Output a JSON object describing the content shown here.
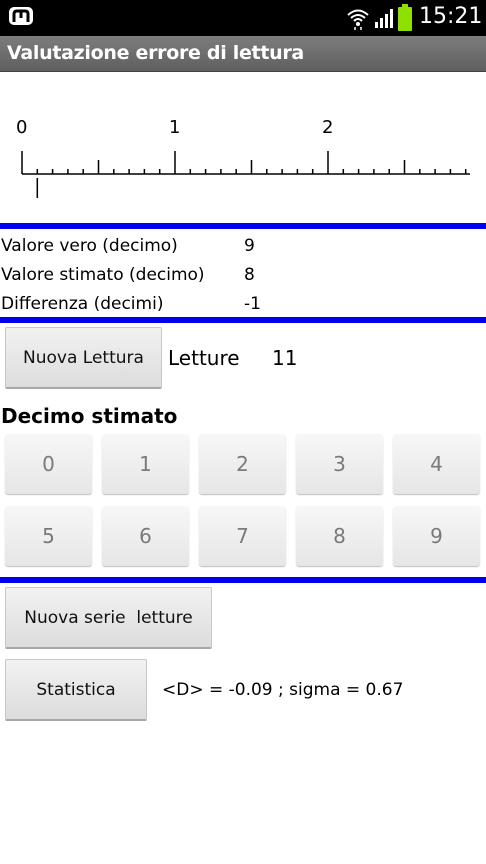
{
  "status_bar": {
    "time": "15:21",
    "icons": [
      "app-notification-icon",
      "wifi-icon",
      "signal-icon",
      "battery-icon"
    ],
    "battery_color": "#8ee000"
  },
  "app": {
    "title": "Valutazione errore di lettura"
  },
  "ruler": {
    "labels": [
      "0",
      "1",
      "2"
    ],
    "units_shown": 3,
    "divisions_per_unit": 10,
    "pointer_value": 0.1,
    "color": "#000000"
  },
  "info": {
    "valore_vero": {
      "label": "Valore vero (decimo)",
      "value": "9"
    },
    "valore_stimato": {
      "label": "Valore stimato (decimo)",
      "value": "8"
    },
    "differenza": {
      "label": "Differenza (decimi)",
      "value": "-1"
    }
  },
  "reading": {
    "button_label": "Nuova Lettura",
    "letture_label": "Letture",
    "letture_count": "11"
  },
  "estimate": {
    "title": "Decimo stimato",
    "digits": [
      "0",
      "1",
      "2",
      "3",
      "4",
      "5",
      "6",
      "7",
      "8",
      "9"
    ]
  },
  "series": {
    "button_label": "Nuova serie  letture"
  },
  "stats": {
    "button_label": "Statistica",
    "result": "<D> = -0.09 ;  sigma = 0.67"
  },
  "colors": {
    "separator": "#0000ee",
    "titlebar": "#6e6e6e",
    "statusbar": "#000000"
  }
}
